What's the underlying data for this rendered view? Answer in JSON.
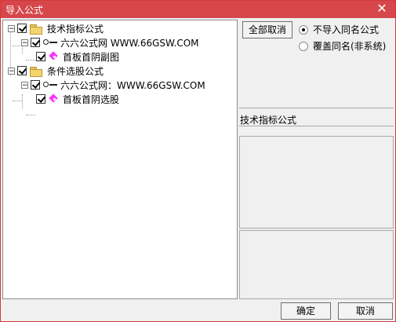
{
  "window": {
    "title": "导入公式",
    "close_label": "✕"
  },
  "tree": {
    "groups": [
      {
        "label": "技术指标公式",
        "expander": "−",
        "site_label": "六六公式网 WWW.66GSW.COM",
        "formula_label": "首板首阴副图"
      },
      {
        "label": "条件选股公式",
        "expander": "−",
        "site_label": "六六公式网：WWW.66GSW.COM",
        "formula_label": "首板首阴选股"
      }
    ]
  },
  "controls": {
    "uncheck_all_label": "全部取消",
    "radio_not_import_label": "不导入同名公式",
    "radio_overwrite_label": "覆盖同名(非系统)"
  },
  "right_panel": {
    "title": "技术指标公式"
  },
  "footer": {
    "ok_label": "确定",
    "cancel_label": "取消"
  }
}
